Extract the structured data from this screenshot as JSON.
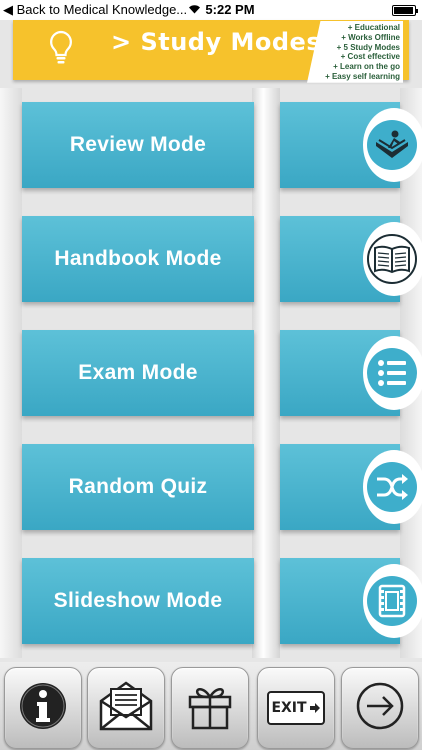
{
  "status_bar": {
    "back_label": "◀ Back to Medical Knowledge...",
    "time": "5:22 PM",
    "battery_level": 0.95
  },
  "banner": {
    "title": "> Study Modes",
    "icon": "lightbulb-icon",
    "color": "#f6c22c",
    "features": [
      "+ Educational",
      "+ Works Offline",
      "+ 5 Study Modes",
      "+ Cost effective",
      "+ Learn on the go",
      "+ Easy self learning"
    ]
  },
  "modes": [
    {
      "label": "Review Mode",
      "icon": "reader-icon"
    },
    {
      "label": "Handbook Mode",
      "icon": "book-icon"
    },
    {
      "label": "Exam Mode",
      "icon": "list-icon"
    },
    {
      "label": "Random Quiz",
      "icon": "shuffle-icon"
    },
    {
      "label": "Slideshow Mode",
      "icon": "film-icon"
    }
  ],
  "toolbar": {
    "buttons": [
      {
        "icon": "info-icon"
      },
      {
        "icon": "mail-icon"
      },
      {
        "icon": "gift-icon"
      },
      {
        "icon": "exit-icon",
        "label": "EXIT"
      },
      {
        "icon": "arrow-right-icon"
      }
    ]
  },
  "colors": {
    "accent": "#3eaecb",
    "banner": "#f6c22c",
    "background": "#e6e6e6"
  }
}
